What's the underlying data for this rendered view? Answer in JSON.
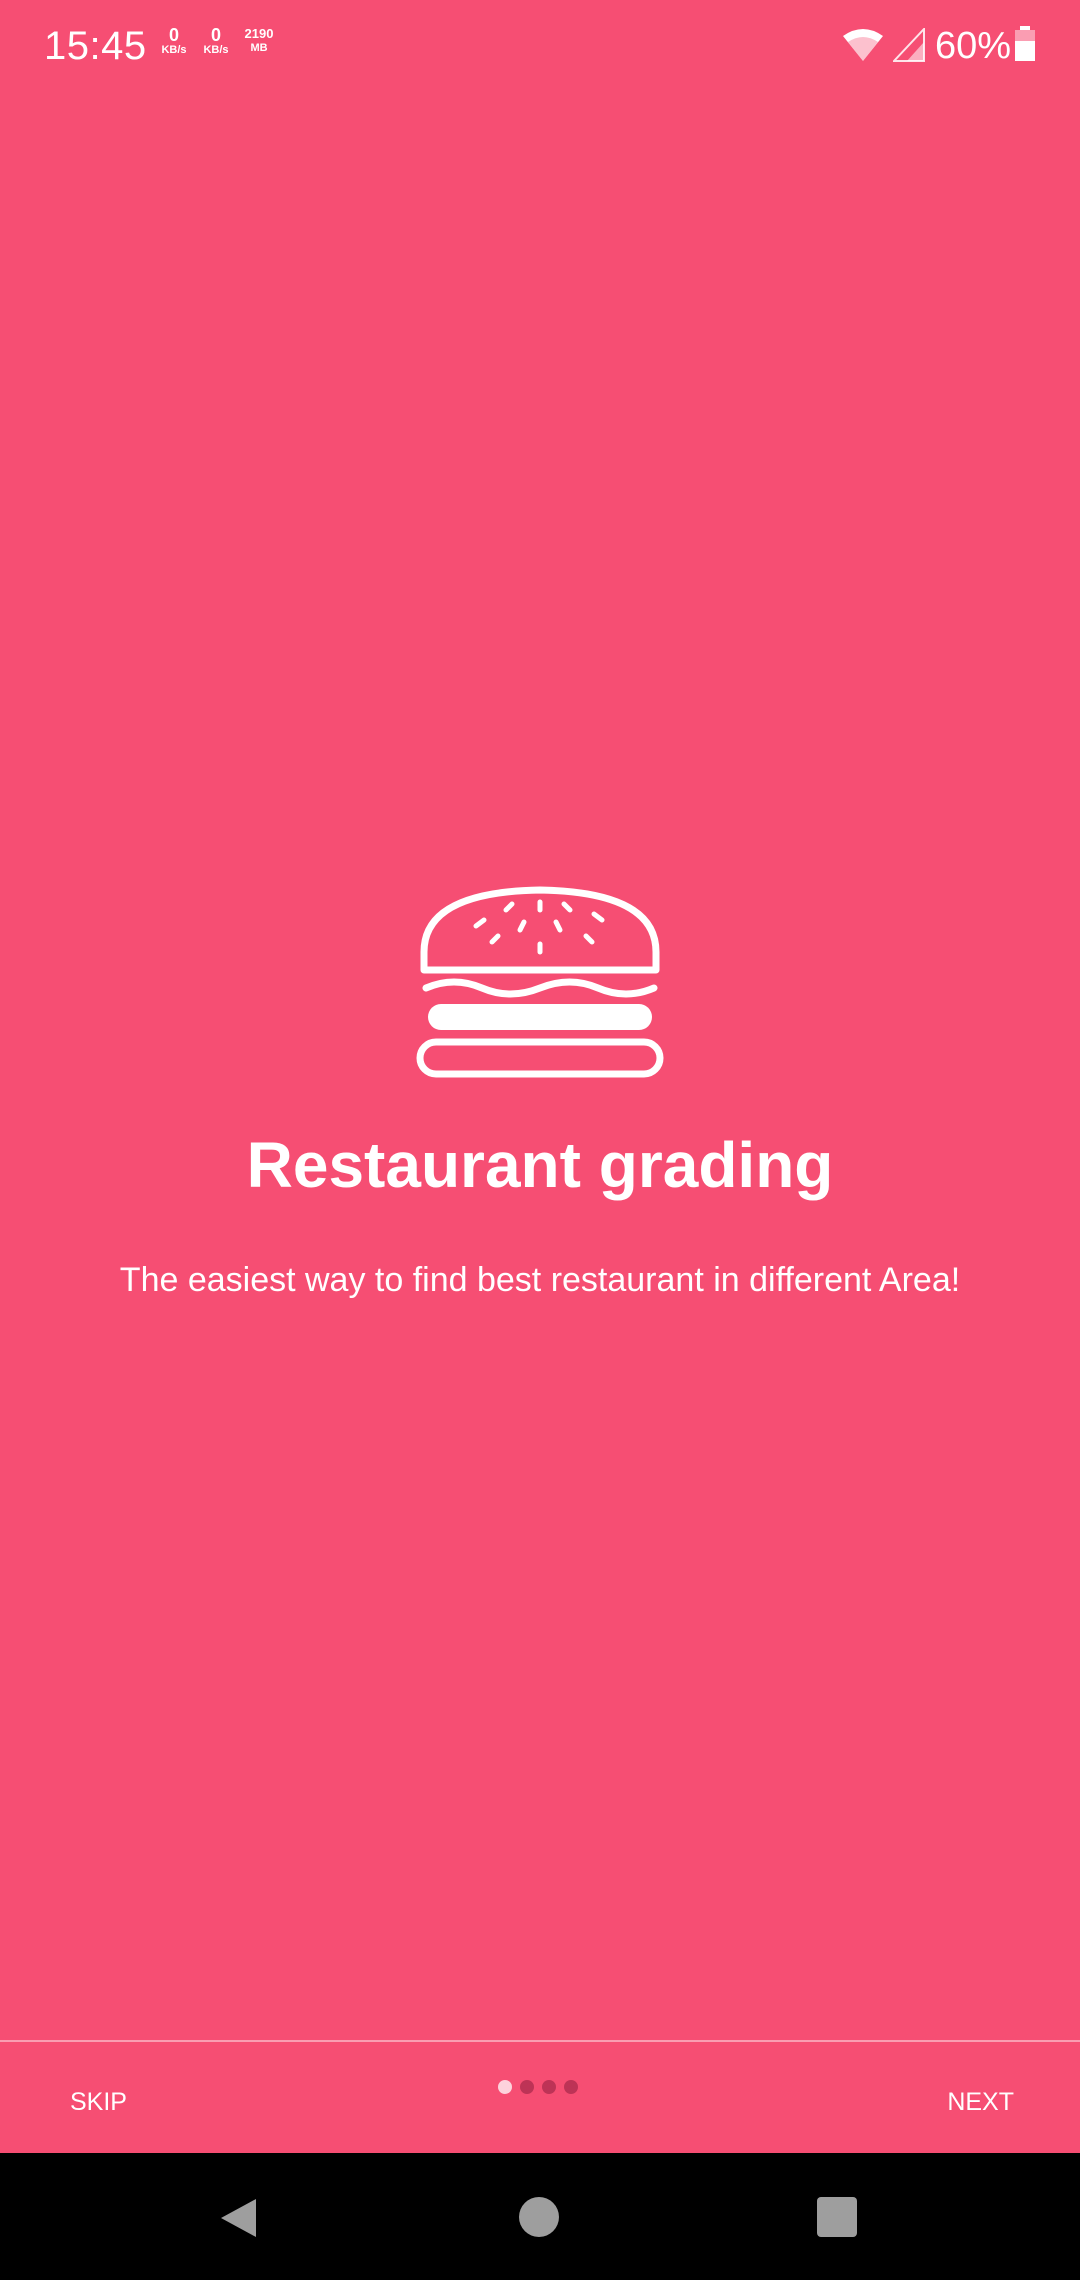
{
  "status_bar": {
    "time": "15:45",
    "net_stats": [
      {
        "value": "0",
        "unit": "KB/s"
      },
      {
        "value": "0",
        "unit": "KB/s"
      },
      {
        "value": "2190",
        "unit": "MB"
      }
    ],
    "battery_percent": "60%",
    "icons": [
      "wifi-icon",
      "signal-icon",
      "battery-icon"
    ]
  },
  "slide": {
    "icon": "burger-icon",
    "title": "Restaurant grading",
    "description": "The easiest way to find best restaurant in different Area!"
  },
  "onboarding_bar": {
    "skip_label": "SKIP",
    "next_label": "NEXT",
    "page_count": 4,
    "current_page": 1
  },
  "nav_bar": {
    "icons": [
      "back-icon",
      "home-icon",
      "recents-icon"
    ]
  },
  "colors": {
    "background": "#F64E73",
    "foreground": "#FFFFFF",
    "nav_background": "#000000"
  }
}
